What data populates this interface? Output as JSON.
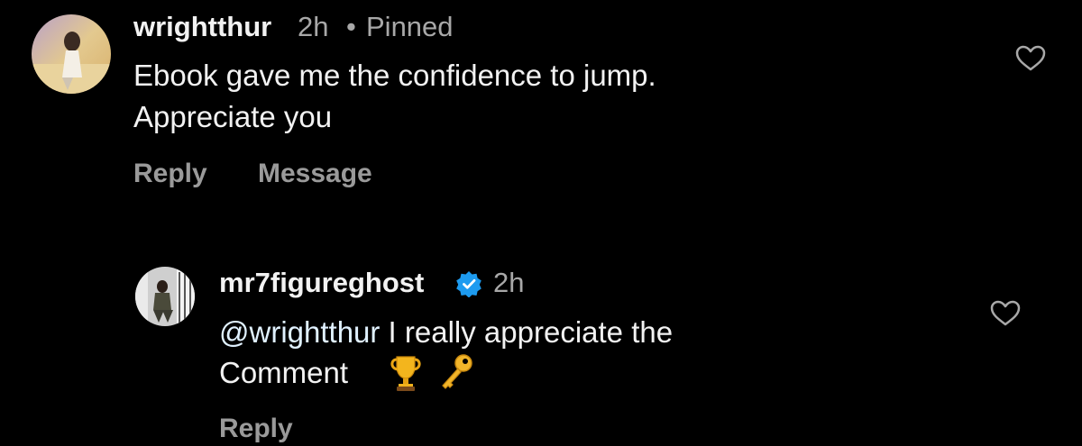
{
  "comments": [
    {
      "username": "wrightthur",
      "time": "2h",
      "separator": "•",
      "pinned_label": "Pinned",
      "lines": [
        "Ebook gave me the confidence to jump.",
        "Appreciate you"
      ],
      "actions": {
        "reply": "Reply",
        "message": "Message"
      },
      "icons": {
        "like": "heart-outline-icon"
      }
    },
    {
      "username": "mr7figureghost",
      "verified": true,
      "time": "2h",
      "mention": "@wrightthur",
      "line1_rest": " I really appreciate the",
      "line2": "Comment",
      "emojis": [
        "trophy-icon",
        "key-icon"
      ],
      "actions": {
        "reply": "Reply"
      },
      "icons": {
        "like": "heart-outline-icon"
      },
      "colors": {
        "verified_badge": "#1d9bf0"
      }
    }
  ]
}
